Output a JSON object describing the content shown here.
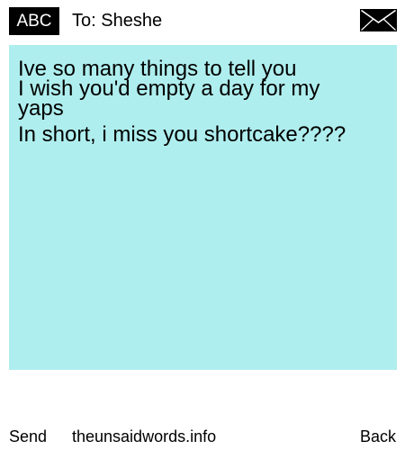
{
  "header": {
    "badge_label": "ABC",
    "recipient": "To: Sheshe",
    "mail_icon": "envelope-icon"
  },
  "message": {
    "background_color": "#afeeee",
    "lines": [
      "Ive so many things to tell you",
      "I wish you'd empty a day for my",
      "yaps",
      "In short, i miss you shortcake????"
    ]
  },
  "footer": {
    "send_label": "Send",
    "site_label": "theunsaidwords.info",
    "back_label": "Back"
  }
}
